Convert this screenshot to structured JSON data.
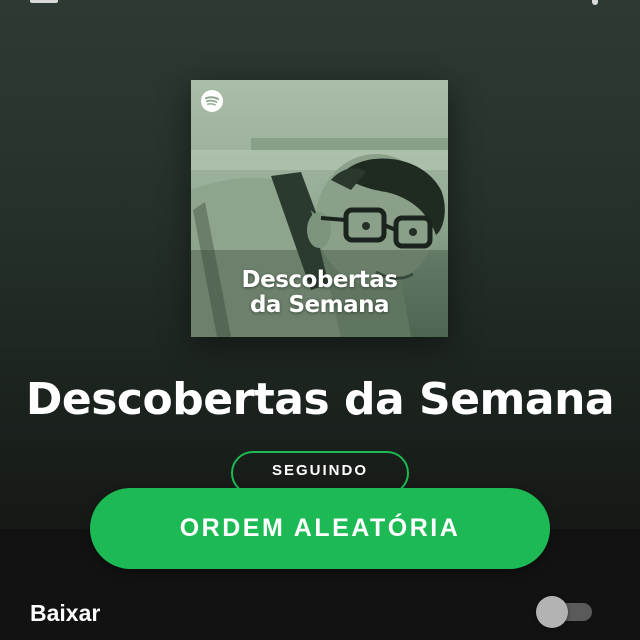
{
  "playlist": {
    "cover_title_line1": "Descobertas",
    "cover_title_line2": "da Semana",
    "title": "Descobertas da Semana",
    "follow_label": "SEGUINDO",
    "shuffle_label": "ORDEM ALEATÓRIA"
  },
  "download": {
    "label": "Baixar",
    "enabled": false
  },
  "icons": {
    "cover_brand": "spotify-icon"
  },
  "colors": {
    "accent": "#1db954",
    "background_top": "#2d3a33",
    "background_bottom": "#121212",
    "toggle_off_thumb": "#b3b3b3",
    "toggle_off_track": "#5a5a5a"
  }
}
